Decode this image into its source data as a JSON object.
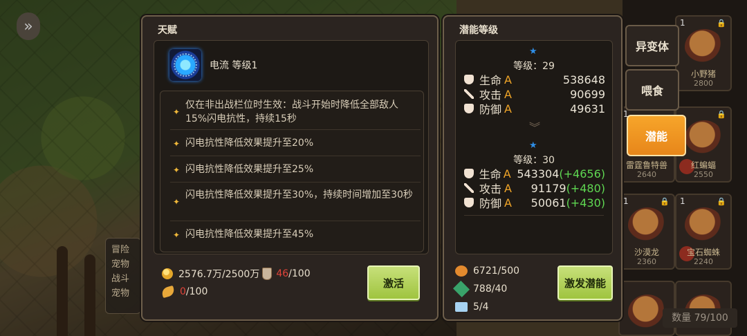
{
  "background": {
    "left_box_lines": [
      "冒险",
      "宠物",
      "战斗",
      "宠物"
    ],
    "right_cards": [
      {
        "num": "1",
        "name": "小野猪",
        "value": "2800"
      },
      {
        "num": "1",
        "name": "雷霆鲁特兽",
        "value": "2640"
      },
      {
        "num": "",
        "name": "红蝙蝠",
        "value": "2550"
      },
      {
        "num": "1",
        "name": "沙漠龙",
        "value": "2360"
      },
      {
        "num": "1",
        "name": "宝石蜘蛛",
        "value": "2240"
      }
    ],
    "count_label": "数量 79/100"
  },
  "talent_panel": {
    "title": "天赋",
    "talent_name": "电流 等级1",
    "effects": [
      "仅在非出战栏位时生效：战斗开始时降低全部敌人15%闪电抗性，持续15秒",
      "闪电抗性降低效果提升至20%",
      "闪电抗性降低效果提升至25%",
      "闪电抗性降低效果提升至30%，持续时间增加至30秒",
      "闪电抗性降低效果提升至45%"
    ],
    "gold": "2576.7万/2500万",
    "flask_current": "46",
    "flask_max": "/100",
    "wing_current": "0",
    "wing_max": "/100",
    "activate_button": "激活"
  },
  "potential_panel": {
    "title": "潜能等级",
    "current": {
      "level": "等级：29",
      "stats": [
        {
          "label": "生命",
          "grade": "A",
          "value": "538648",
          "plus": ""
        },
        {
          "label": "攻击",
          "grade": "A",
          "value": "90699",
          "plus": ""
        },
        {
          "label": "防御",
          "grade": "A",
          "value": "49631",
          "plus": ""
        }
      ]
    },
    "next": {
      "level": "等级：30",
      "stats": [
        {
          "label": "生命",
          "grade": "A",
          "value": "543304",
          "plus": "(+4656)"
        },
        {
          "label": "攻击",
          "grade": "A",
          "value": "91179",
          "plus": "(+480)"
        },
        {
          "label": "防御",
          "grade": "A",
          "value": "50061",
          "plus": "(+430)"
        }
      ]
    },
    "resources": [
      "6721/500",
      "788/40",
      "5/4"
    ],
    "awaken_button": "激发潜能"
  },
  "side_buttons": [
    "异变体",
    "喂食",
    "潜能"
  ],
  "colors": {
    "accent_orange": "#f7a52a",
    "button_green": "#9fc43f",
    "plus_green": "#5fd852",
    "grade_orange": "#f0a528"
  }
}
